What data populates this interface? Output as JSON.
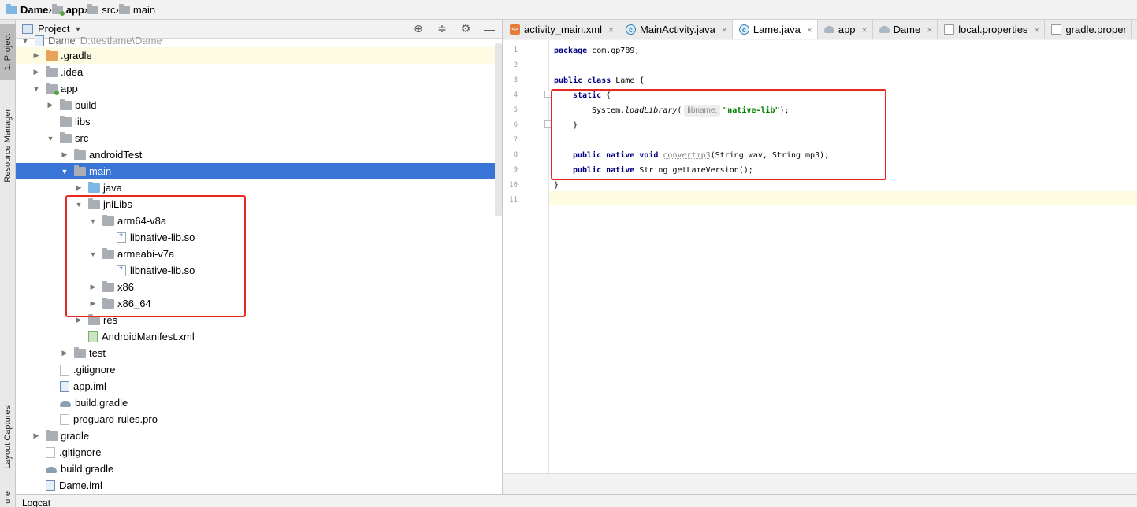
{
  "breadcrumb": [
    {
      "label": "Dame",
      "bold": true,
      "icon": "project-folder-icon"
    },
    {
      "label": "app",
      "bold": true,
      "icon": "module-folder-icon"
    },
    {
      "label": "src",
      "bold": false,
      "icon": "folder-icon"
    },
    {
      "label": "main",
      "bold": false,
      "icon": "folder-icon"
    }
  ],
  "left_strip": {
    "project_tab": "1: Project",
    "resource_manager_tab": "Resource Manager",
    "layout_captures_tab": "Layout Captures",
    "structure_tab_fragment": "ure"
  },
  "project_panel": {
    "title": "Project",
    "dropdown_glyph": "▼",
    "tools": [
      "locate-icon",
      "collapse-all-icon",
      "settings-gear-icon",
      "hide-panel-icon"
    ],
    "root_partial": {
      "label": "Dame",
      "path": "D:\\testlame\\Dame"
    },
    "tree": [
      {
        "label": ".gradle",
        "indent": 1,
        "arrow": "▶",
        "icon": "folder-orange",
        "hl": true
      },
      {
        "label": ".idea",
        "indent": 1,
        "arrow": "▶",
        "icon": "folder"
      },
      {
        "label": "app",
        "indent": 1,
        "arrow": "▼",
        "icon": "folder-module"
      },
      {
        "label": "build",
        "indent": 2,
        "arrow": "▶",
        "icon": "folder"
      },
      {
        "label": "libs",
        "indent": 2,
        "arrow": "",
        "icon": "folder"
      },
      {
        "label": "src",
        "indent": 2,
        "arrow": "▼",
        "icon": "folder"
      },
      {
        "label": "androidTest",
        "indent": 3,
        "arrow": "▶",
        "icon": "folder"
      },
      {
        "label": "main",
        "indent": 3,
        "arrow": "▼",
        "icon": "folder",
        "selected": true
      },
      {
        "label": "java",
        "indent": 4,
        "arrow": "▶",
        "icon": "folder-blue"
      },
      {
        "label": "jniLibs",
        "indent": 4,
        "arrow": "▼",
        "icon": "folder"
      },
      {
        "label": "arm64-v8a",
        "indent": 5,
        "arrow": "▼",
        "icon": "folder"
      },
      {
        "label": "libnative-lib.so",
        "indent": 6,
        "arrow": "",
        "icon": "file-so"
      },
      {
        "label": "armeabi-v7a",
        "indent": 5,
        "arrow": "▼",
        "icon": "folder"
      },
      {
        "label": "libnative-lib.so",
        "indent": 6,
        "arrow": "",
        "icon": "file-so"
      },
      {
        "label": "x86",
        "indent": 5,
        "arrow": "▶",
        "icon": "folder"
      },
      {
        "label": "x86_64",
        "indent": 5,
        "arrow": "▶",
        "icon": "folder"
      },
      {
        "label": "res",
        "indent": 4,
        "arrow": "▶",
        "icon": "folder"
      },
      {
        "label": "AndroidManifest.xml",
        "indent": 4,
        "arrow": "",
        "icon": "file-manifest"
      },
      {
        "label": "test",
        "indent": 3,
        "arrow": "▶",
        "icon": "folder"
      },
      {
        "label": ".gitignore",
        "indent": 2,
        "arrow": "",
        "icon": "file"
      },
      {
        "label": "app.iml",
        "indent": 2,
        "arrow": "",
        "icon": "file-iml"
      },
      {
        "label": "build.gradle",
        "indent": 2,
        "arrow": "",
        "icon": "file-gradle"
      },
      {
        "label": "proguard-rules.pro",
        "indent": 2,
        "arrow": "",
        "icon": "file"
      },
      {
        "label": "gradle",
        "indent": 1,
        "arrow": "▶",
        "icon": "folder"
      },
      {
        "label": ".gitignore",
        "indent": 1,
        "arrow": "",
        "icon": "file"
      },
      {
        "label": "build.gradle",
        "indent": 1,
        "arrow": "",
        "icon": "file-gradle"
      },
      {
        "label": "Dame.iml",
        "indent": 1,
        "arrow": "",
        "icon": "file-iml"
      }
    ]
  },
  "editor_tabs": [
    {
      "label": "activity_main.xml",
      "icon": "xml",
      "active": false
    },
    {
      "label": "MainActivity.java",
      "icon": "java",
      "active": false
    },
    {
      "label": "Lame.java",
      "icon": "java",
      "active": true
    },
    {
      "label": "app",
      "icon": "grd",
      "active": false
    },
    {
      "label": "Dame",
      "icon": "grd",
      "active": false
    },
    {
      "label": "local.properties",
      "icon": "prop",
      "active": false
    },
    {
      "label": "gradle.proper",
      "icon": "prop",
      "active": false,
      "noclose": true
    }
  ],
  "tab_close_glyph": "×",
  "editor": {
    "line_numbers": [
      "1",
      "2",
      "3",
      "4",
      "5",
      "6",
      "7",
      "8",
      "9",
      "10",
      "11"
    ],
    "code": {
      "l1_kw": "package",
      "l1_rest": " com.qp789;",
      "l3_kw": "public class",
      "l3_rest": " Lame {",
      "l4_kw": "static",
      "l4_rest": " {",
      "l5_pre": "System.",
      "l5_method": "loadLibrary",
      "l5_open": "(",
      "l5_hint": "libname:",
      "l5_str": "\"native-lib\"",
      "l5_close": ");",
      "l6": "}",
      "l8_kw": "public native void",
      "l8_method": "convertmp3",
      "l8_rest": "(String wav, String mp3);",
      "l9_kw": "public native",
      "l9_rest": " String getLameVersion();",
      "l10": "}"
    }
  },
  "status_bar": {
    "label": "Logcat"
  },
  "colors": {
    "selection": "#3875d6",
    "annotation_box": "#e8281e",
    "keyword": "#000080",
    "string": "#008000"
  }
}
